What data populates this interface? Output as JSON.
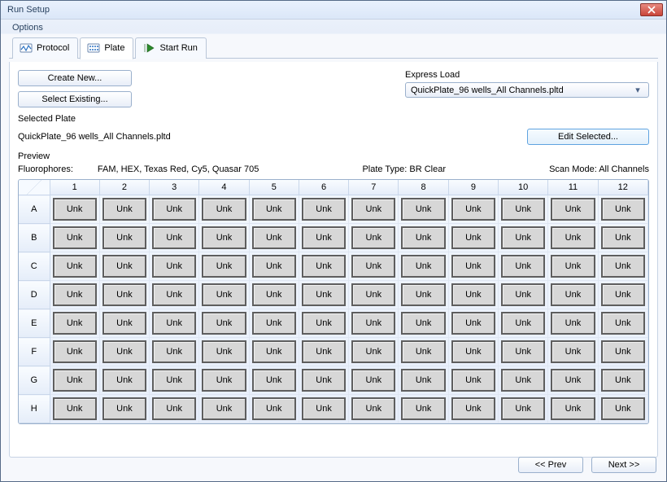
{
  "window": {
    "title": "Run Setup"
  },
  "menu": {
    "options": "Options"
  },
  "tabs": {
    "protocol": "Protocol",
    "plate": "Plate",
    "start_run": "Start Run",
    "active": "plate"
  },
  "buttons": {
    "create_new": "Create New...",
    "select_existing": "Select Existing...",
    "edit_selected": "Edit Selected...",
    "prev": "<< Prev",
    "next": "Next >>"
  },
  "express_load": {
    "label": "Express Load",
    "value": "QuickPlate_96 wells_All Channels.pltd"
  },
  "selected_plate": {
    "label": "Selected Plate",
    "value": "QuickPlate_96 wells_All Channels.pltd"
  },
  "preview": {
    "label": "Preview",
    "fluorophores_label": "Fluorophores:",
    "fluorophores_value": "FAM, HEX, Texas Red, Cy5, Quasar 705",
    "plate_type_label": "Plate Type:",
    "plate_type_value": "BR Clear",
    "scan_mode_label": "Scan Mode:",
    "scan_mode_value": "All Channels"
  },
  "plate": {
    "columns": [
      "1",
      "2",
      "3",
      "4",
      "5",
      "6",
      "7",
      "8",
      "9",
      "10",
      "11",
      "12"
    ],
    "rows": [
      "A",
      "B",
      "C",
      "D",
      "E",
      "F",
      "G",
      "H"
    ],
    "cell_label": "Unk"
  }
}
